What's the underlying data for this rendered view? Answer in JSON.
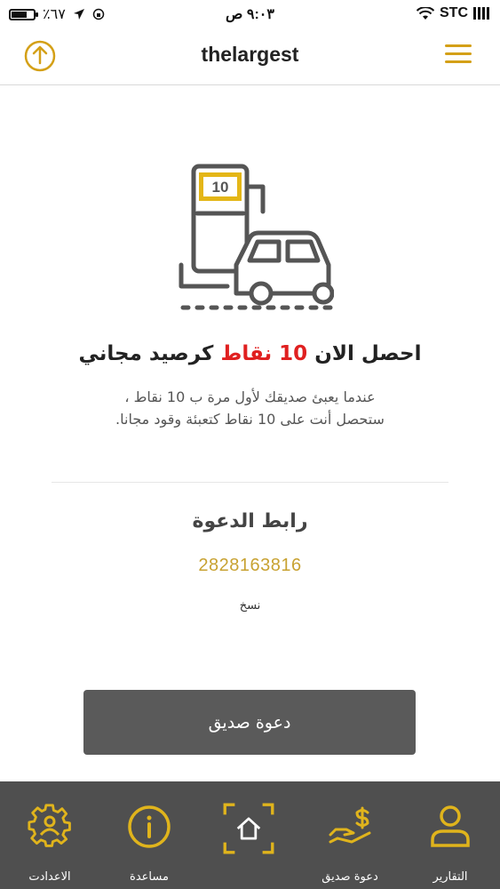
{
  "status_bar": {
    "carrier": "STC",
    "time": "٩:٠٣ ص",
    "battery_percent": "٪٦٧",
    "battery_level": 0.67
  },
  "header": {
    "title": "thelargest",
    "logout_icon": "power-upload-icon",
    "menu_icon": "hamburger-menu-icon"
  },
  "illustration": {
    "pump_value": "10"
  },
  "promo": {
    "headline_prefix": "احصل الان",
    "headline_points": "10 نقاط",
    "headline_suffix": "كرصيد مجاني",
    "description_line1": "عندما يعبئ صديقك لأول مرة ب 10 نقاط ،",
    "description_line2": "ستحصل أنت على 10 نقاط كتعبئة وقود مجانا."
  },
  "invite": {
    "title": "رابط الدعوة",
    "code": "2828163816",
    "copy_label": "نسخ",
    "button_label": "دعوة صديق"
  },
  "bottom_nav": {
    "items": [
      {
        "label": "الاعدادت",
        "icon": "gear-user-icon"
      },
      {
        "label": "مساعدة",
        "icon": "info-icon"
      },
      {
        "label": "",
        "icon": "home-icon"
      },
      {
        "label": "دعوة صديق",
        "icon": "money-hand-icon"
      },
      {
        "label": "التقارير",
        "icon": "user-icon"
      }
    ]
  },
  "colors": {
    "accent": "#d4a017",
    "highlight_red": "#e02020",
    "button_bg": "#5a5a5a",
    "nav_bg": "#4f4f4f",
    "code_gold": "#c8a232"
  }
}
